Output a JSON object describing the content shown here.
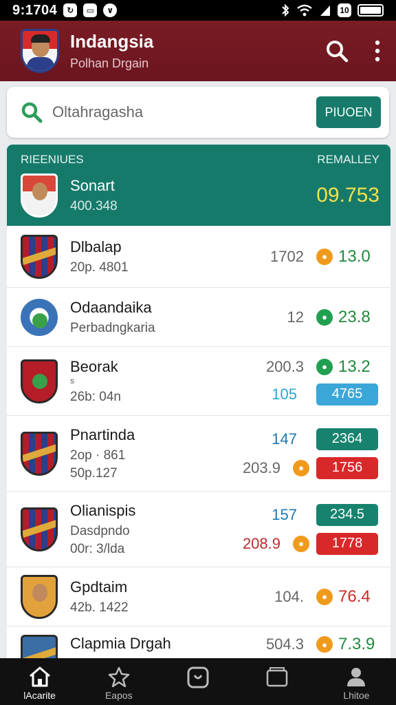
{
  "status_bar": {
    "time": "9:1704",
    "icons": [
      "sync-icon",
      "tv-icon",
      "chevron-icon"
    ],
    "right_icons": [
      "bluetooth-icon",
      "wifi-icon",
      "signal-icon",
      "sim-icon",
      "battery-icon"
    ],
    "sim_label": "10"
  },
  "app_bar": {
    "title": "Indangsia",
    "subtitle": "Polhan Drgain",
    "logo": "player-portrait-logo",
    "actions": [
      "search-icon",
      "more-vert-icon"
    ]
  },
  "search": {
    "value": "Oltahragasha",
    "button_label": "PIUOEN",
    "icon": "search-icon",
    "accent": "#2e9e5b"
  },
  "board": {
    "header": {
      "left_label": "RIEENIUES",
      "right_label": "REMALLEY",
      "name": "Sonart",
      "sub": "400.348",
      "score": "09.753"
    },
    "rows": [
      {
        "name": "Dlbalap",
        "sub": "20p. 4801",
        "val": "1702",
        "score": "13.0"
      },
      {
        "name": "Odaandaika",
        "sub": "Perbadngkaria",
        "val": "12",
        "score": "23.8"
      },
      {
        "name": "Beorak",
        "mark": "s",
        "sub": "26b: 04n",
        "val_top": "200.3",
        "score_top": "13.2",
        "val_bottom": "105",
        "pill": "4765"
      },
      {
        "name": "Pnartinda",
        "sub1": "2op · 861",
        "sub2": "50p.127",
        "val_top": "147",
        "pill_top": "2364",
        "val_bottom": "203.9",
        "pill_bottom": "1756"
      },
      {
        "name": "Olianispis",
        "sub1": "Dasdpndo",
        "sub2": "00r: 3/lda",
        "val_top": "157",
        "pill_top": "234.5",
        "val_bottom": "208.9",
        "pill_bottom": "1778"
      },
      {
        "name": "Gpdtaim",
        "sub": "42b. 1422",
        "val": "104.",
        "score": "76.4"
      },
      {
        "name": "Clapmia Drgah",
        "val": "504.3",
        "score": "7.3.9"
      }
    ]
  },
  "bottom_nav": [
    {
      "label": "lAcarite",
      "icon": "home-icon",
      "active": true
    },
    {
      "label": "Eapos",
      "icon": "star-icon",
      "active": false
    },
    {
      "label": "",
      "icon": "app-square-icon",
      "active": false
    },
    {
      "label": "",
      "icon": "folder-icon",
      "active": false
    },
    {
      "label": "Lhitoe",
      "icon": "person-icon",
      "active": false
    }
  ]
}
